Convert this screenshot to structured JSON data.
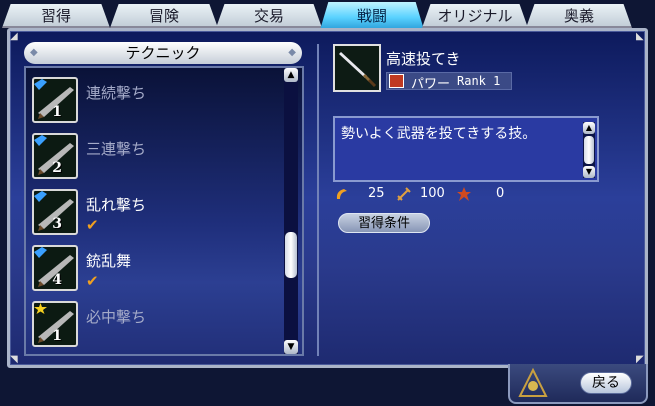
{
  "tabs": [
    {
      "label": "習得",
      "active": false
    },
    {
      "label": "冒険",
      "active": false
    },
    {
      "label": "交易",
      "active": false
    },
    {
      "label": "戦闘",
      "active": true
    },
    {
      "label": "オリジナル",
      "active": false
    },
    {
      "label": "奥義",
      "active": false
    }
  ],
  "list": {
    "header": "テクニック",
    "skills": [
      {
        "name": "連続撃ち",
        "rank": "1",
        "learned": false,
        "type_icon": "blue-arrow-icon"
      },
      {
        "name": "三連撃ち",
        "rank": "2",
        "learned": false,
        "type_icon": "blue-arrow-icon"
      },
      {
        "name": "乱れ撃ち",
        "rank": "3",
        "learned": true,
        "type_icon": "blue-arrow-icon"
      },
      {
        "name": "銃乱舞",
        "rank": "4",
        "learned": true,
        "type_icon": "blue-arrow-icon"
      },
      {
        "name": "必中撃ち",
        "rank": "1",
        "learned": false,
        "type_icon": "yellow-star-icon"
      }
    ],
    "check_mark": "✔"
  },
  "detail": {
    "name": "高速投てき",
    "type": "パワー",
    "rank_label": "Rank  1",
    "description": "勢いよく武器を投てきする技。",
    "stats": [
      {
        "icon": "power-icon",
        "value": "25"
      },
      {
        "icon": "durability-icon",
        "value": "100"
      },
      {
        "icon": "fatigue-icon",
        "value": "0"
      }
    ],
    "condition_button": "習得条件"
  },
  "footer": {
    "back_button": "戻る"
  },
  "colors": {
    "active_tab": "#5ad2ff",
    "panel_bg": "#2b3f9a",
    "learned_check": "#f0a020"
  }
}
